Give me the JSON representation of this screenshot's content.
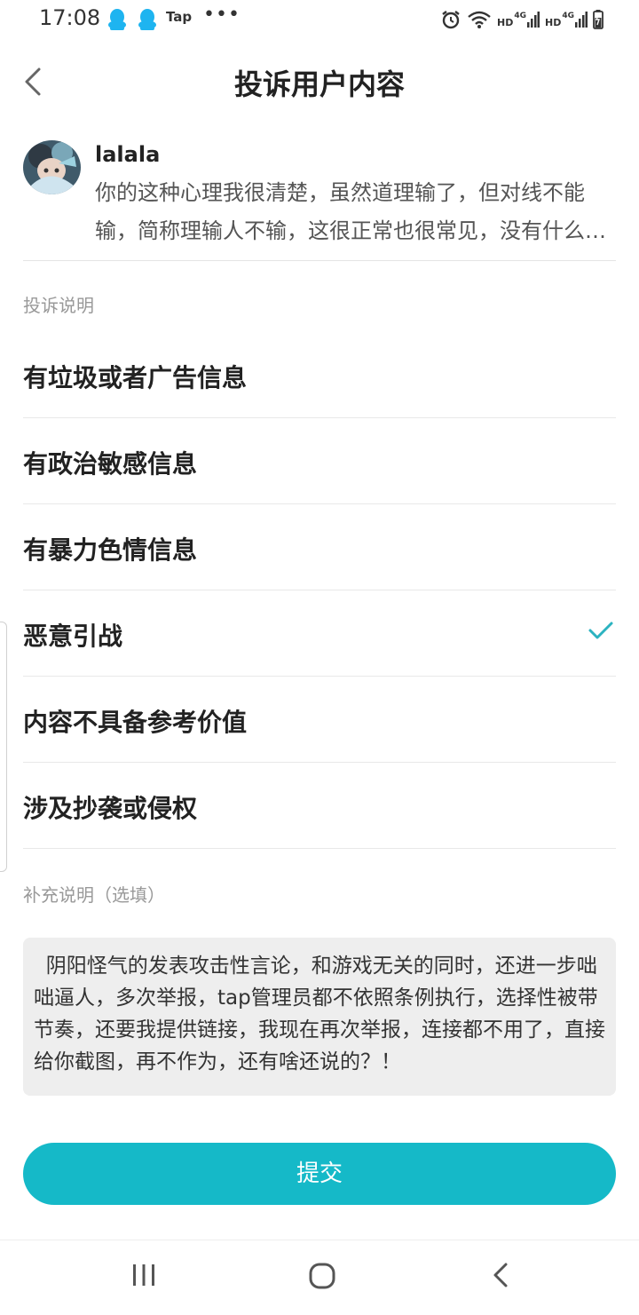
{
  "status_bar": {
    "time": "17:08",
    "app_tag": "Tap",
    "more": "•••",
    "hd": "HD",
    "net": "4G"
  },
  "header": {
    "title": "投诉用户内容"
  },
  "post": {
    "username": "lalala",
    "text": "你的这种心理我很清楚，虽然道理输了，但对线不能输，简称理输人不输，这很正常也很常见，没有什么好奇怪的"
  },
  "complaint_section_label": "投诉说明",
  "reasons": [
    {
      "label": "有垃圾或者广告信息",
      "selected": false
    },
    {
      "label": "有政治敏感信息",
      "selected": false
    },
    {
      "label": "有暴力色情信息",
      "selected": false
    },
    {
      "label": "恶意引战",
      "selected": true
    },
    {
      "label": "内容不具备参考价值",
      "selected": false
    },
    {
      "label": "涉及抄袭或侵权",
      "selected": false
    }
  ],
  "supplement_label": "补充说明（选填）",
  "supplement_text": "阴阳怪气的发表攻击性言论，和游戏无关的同时，还进一步咄咄逼人，多次举报，tap管理员都不依照条例执行，选择性被带节奏，还要我提供链接，我现在再次举报，连接都不用了，直接给你截图，再不作为，还有啥还说的？！",
  "submit_label": "提交",
  "colors": {
    "accent": "#15b9c8",
    "check": "#2bb3c0"
  },
  "icons": [
    "qq-icon",
    "alarm-icon",
    "wifi-icon",
    "signal-icon",
    "battery-icon",
    "back-arrow-icon",
    "check-icon",
    "recents-icon",
    "home-icon",
    "system-back-icon"
  ]
}
